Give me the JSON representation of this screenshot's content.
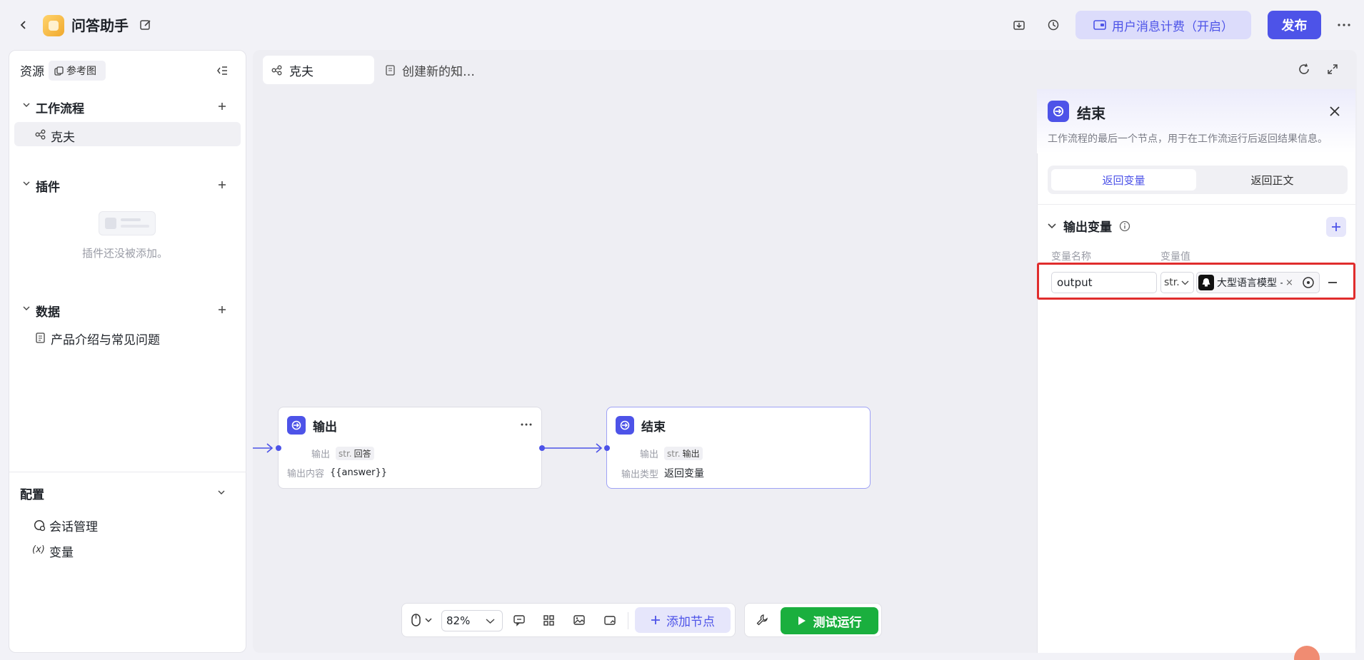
{
  "header": {
    "app_title": "问答助手",
    "billing_label": "用户消息计费（开启）",
    "publish_label": "发布"
  },
  "sidebar": {
    "resources_label": "资源",
    "reference_badge": "参考图",
    "sections": {
      "workflow": {
        "title": "工作流程",
        "items": [
          "克夫"
        ]
      },
      "plugins": {
        "title": "插件",
        "empty_text": "插件还没被添加。"
      },
      "data": {
        "title": "数据",
        "items": [
          "产品介绍与常见问题"
        ]
      }
    },
    "config": {
      "title": "配置",
      "items": [
        "会话管理",
        "变量"
      ]
    }
  },
  "canvas": {
    "tabs": [
      "克夫",
      "创建新的知…"
    ],
    "nodes": {
      "output": {
        "title": "输出",
        "row1_label": "输出",
        "row1_type": "str.",
        "row1_value": "回答",
        "row2_label": "输出内容",
        "row2_value": "{{answer}}"
      },
      "end": {
        "title": "结束",
        "row1_label": "输出",
        "row1_type": "str.",
        "row1_value": "输出",
        "row2_label": "输出类型",
        "row2_value": "返回变量"
      }
    }
  },
  "panel": {
    "title": "结束",
    "description": "工作流程的最后一个节点，用于在工作流运行后返回结果信息。",
    "segments": [
      "返回变量",
      "返回正文"
    ],
    "active_segment": "返回变量",
    "output_vars_title": "输出变量",
    "col_name": "变量名称",
    "col_value": "变量值",
    "variable": {
      "name": "output",
      "type": "str.",
      "reference": "大型语言模型 -",
      "clear": "×"
    }
  },
  "toolbar": {
    "zoom": "82%",
    "add_node_label": "添加节点",
    "test_run_label": "测试运行"
  },
  "colors": {
    "accent": "#4d53e8",
    "run_green": "#1aaf3e",
    "highlight_red": "#e02d2d"
  }
}
